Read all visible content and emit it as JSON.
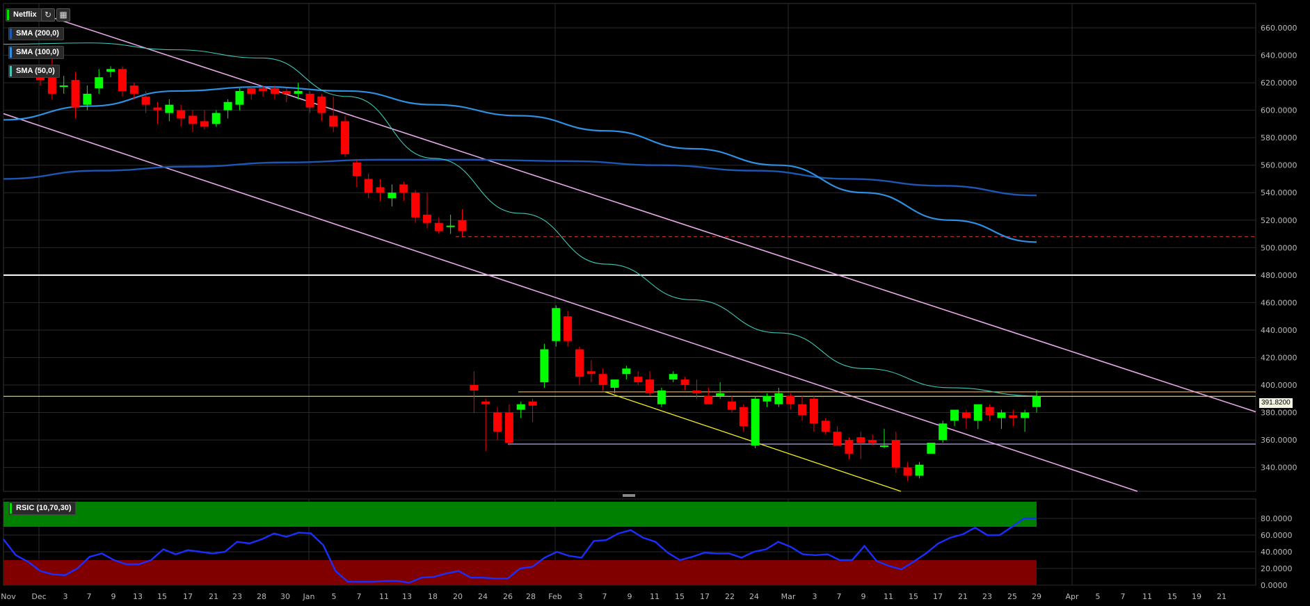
{
  "symbol": "Netflix",
  "indicators": [
    "SMA (200,0)",
    "SMA (100,0)",
    "SMA (50,0)"
  ],
  "rsi_label": "RSIC (10,70,30)",
  "last_price": "391.8200",
  "colors": {
    "background": "#000000",
    "grid": "#2a2a2a",
    "bull": "#00ff00",
    "bear": "#ff0000",
    "sma200": "#1e56b4",
    "sma100": "#2f8fe0",
    "sma50": "#3ec9b8",
    "channel": "#e8a8e8",
    "rsi_line": "#1a2fff",
    "overbought": "#008000",
    "oversold": "#800000"
  },
  "chart_data": {
    "type": "candlestick",
    "price_ticks": [
      "660.0000",
      "640.0000",
      "620.0000",
      "600.0000",
      "580.0000",
      "560.0000",
      "540.0000",
      "520.0000",
      "500.0000",
      "480.0000",
      "460.0000",
      "440.0000",
      "420.0000",
      "400.0000",
      "380.0000",
      "360.0000",
      "340.0000"
    ],
    "rsi_ticks": [
      "80.0000",
      "60.0000",
      "40.0000",
      "20.0000",
      "0.0000"
    ],
    "x_labels": [
      "Nov",
      "Dec",
      "3",
      "7",
      "9",
      "13",
      "15",
      "17",
      "21",
      "23",
      "28",
      "30",
      "Jan",
      "5",
      "7",
      "11",
      "13",
      "18",
      "20",
      "24",
      "26",
      "28",
      "Feb",
      "3",
      "7",
      "9",
      "11",
      "15",
      "17",
      "22",
      "24",
      "Mar",
      "3",
      "7",
      "9",
      "11",
      "15",
      "17",
      "21",
      "23",
      "25",
      "29",
      "Apr",
      "5",
      "7",
      "11",
      "15",
      "19",
      "21"
    ],
    "candles": [
      {
        "o": 628,
        "h": 632,
        "l": 618,
        "c": 622
      },
      {
        "o": 624,
        "h": 640,
        "l": 608,
        "c": 612
      },
      {
        "o": 618,
        "h": 625,
        "l": 612,
        "c": 618
      },
      {
        "o": 622,
        "h": 628,
        "l": 594,
        "c": 602
      },
      {
        "o": 604,
        "h": 618,
        "l": 600,
        "c": 612
      },
      {
        "o": 616,
        "h": 630,
        "l": 612,
        "c": 624
      },
      {
        "o": 628,
        "h": 632,
        "l": 624,
        "c": 630
      },
      {
        "o": 630,
        "h": 632,
        "l": 610,
        "c": 614
      },
      {
        "o": 618,
        "h": 620,
        "l": 608,
        "c": 612
      },
      {
        "o": 610,
        "h": 614,
        "l": 598,
        "c": 604
      },
      {
        "o": 602,
        "h": 606,
        "l": 590,
        "c": 600
      },
      {
        "o": 598,
        "h": 608,
        "l": 592,
        "c": 604
      },
      {
        "o": 600,
        "h": 604,
        "l": 588,
        "c": 594
      },
      {
        "o": 596,
        "h": 600,
        "l": 584,
        "c": 590
      },
      {
        "o": 592,
        "h": 600,
        "l": 586,
        "c": 588
      },
      {
        "o": 590,
        "h": 600,
        "l": 588,
        "c": 598
      },
      {
        "o": 600,
        "h": 608,
        "l": 594,
        "c": 606
      },
      {
        "o": 604,
        "h": 616,
        "l": 600,
        "c": 614
      },
      {
        "o": 616,
        "h": 618,
        "l": 608,
        "c": 612
      },
      {
        "o": 616,
        "h": 618,
        "l": 610,
        "c": 614
      },
      {
        "o": 616,
        "h": 618,
        "l": 608,
        "c": 612
      },
      {
        "o": 614,
        "h": 616,
        "l": 606,
        "c": 612
      },
      {
        "o": 612,
        "h": 620,
        "l": 608,
        "c": 614
      },
      {
        "o": 612,
        "h": 614,
        "l": 598,
        "c": 602
      },
      {
        "o": 610,
        "h": 612,
        "l": 592,
        "c": 598
      },
      {
        "o": 596,
        "h": 610,
        "l": 584,
        "c": 588
      },
      {
        "o": 592,
        "h": 596,
        "l": 566,
        "c": 568
      },
      {
        "o": 562,
        "h": 564,
        "l": 544,
        "c": 552
      },
      {
        "o": 550,
        "h": 554,
        "l": 536,
        "c": 540
      },
      {
        "o": 544,
        "h": 550,
        "l": 534,
        "c": 540
      },
      {
        "o": 536,
        "h": 546,
        "l": 530,
        "c": 540
      },
      {
        "o": 546,
        "h": 548,
        "l": 534,
        "c": 540
      },
      {
        "o": 540,
        "h": 542,
        "l": 518,
        "c": 522
      },
      {
        "o": 524,
        "h": 540,
        "l": 514,
        "c": 518
      },
      {
        "o": 518,
        "h": 522,
        "l": 510,
        "c": 512
      },
      {
        "o": 516,
        "h": 524,
        "l": 510,
        "c": 516
      },
      {
        "o": 520,
        "h": 528,
        "l": 508,
        "c": 512
      },
      {
        "o": 400,
        "h": 410,
        "l": 380,
        "c": 396
      },
      {
        "o": 388,
        "h": 390,
        "l": 352,
        "c": 386
      },
      {
        "o": 380,
        "h": 384,
        "l": 360,
        "c": 366
      },
      {
        "o": 380,
        "h": 386,
        "l": 356,
        "c": 358
      },
      {
        "o": 382,
        "h": 388,
        "l": 376,
        "c": 386
      },
      {
        "o": 388,
        "h": 390,
        "l": 373,
        "c": 385
      },
      {
        "o": 402,
        "h": 430,
        "l": 398,
        "c": 426
      },
      {
        "o": 432,
        "h": 458,
        "l": 428,
        "c": 456
      },
      {
        "o": 450,
        "h": 454,
        "l": 428,
        "c": 432
      },
      {
        "o": 426,
        "h": 428,
        "l": 400,
        "c": 406
      },
      {
        "o": 410,
        "h": 418,
        "l": 402,
        "c": 408
      },
      {
        "o": 408,
        "h": 412,
        "l": 396,
        "c": 400
      },
      {
        "o": 398,
        "h": 404,
        "l": 394,
        "c": 404
      },
      {
        "o": 408,
        "h": 414,
        "l": 404,
        "c": 412
      },
      {
        "o": 406,
        "h": 410,
        "l": 400,
        "c": 402
      },
      {
        "o": 404,
        "h": 410,
        "l": 392,
        "c": 394
      },
      {
        "o": 386,
        "h": 398,
        "l": 384,
        "c": 396
      },
      {
        "o": 404,
        "h": 410,
        "l": 402,
        "c": 408
      },
      {
        "o": 404,
        "h": 406,
        "l": 396,
        "c": 400
      },
      {
        "o": 396,
        "h": 404,
        "l": 390,
        "c": 394
      },
      {
        "o": 392,
        "h": 398,
        "l": 386,
        "c": 386
      },
      {
        "o": 392,
        "h": 402,
        "l": 390,
        "c": 394
      },
      {
        "o": 388,
        "h": 392,
        "l": 380,
        "c": 382
      },
      {
        "o": 384,
        "h": 386,
        "l": 366,
        "c": 370
      },
      {
        "o": 356,
        "h": 392,
        "l": 354,
        "c": 390
      },
      {
        "o": 388,
        "h": 394,
        "l": 384,
        "c": 392
      },
      {
        "o": 386,
        "h": 398,
        "l": 384,
        "c": 394
      },
      {
        "o": 392,
        "h": 394,
        "l": 382,
        "c": 386
      },
      {
        "o": 386,
        "h": 392,
        "l": 374,
        "c": 378
      },
      {
        "o": 390,
        "h": 392,
        "l": 366,
        "c": 372
      },
      {
        "o": 374,
        "h": 376,
        "l": 364,
        "c": 366
      },
      {
        "o": 366,
        "h": 370,
        "l": 356,
        "c": 356
      },
      {
        "o": 360,
        "h": 362,
        "l": 346,
        "c": 350
      },
      {
        "o": 362,
        "h": 366,
        "l": 346,
        "c": 358
      },
      {
        "o": 360,
        "h": 364,
        "l": 356,
        "c": 358
      },
      {
        "o": 356,
        "h": 368,
        "l": 354,
        "c": 356
      },
      {
        "o": 360,
        "h": 366,
        "l": 336,
        "c": 340
      },
      {
        "o": 340,
        "h": 344,
        "l": 330,
        "c": 334
      },
      {
        "o": 334,
        "h": 344,
        "l": 332,
        "c": 342
      },
      {
        "o": 350,
        "h": 358,
        "l": 350,
        "c": 358
      },
      {
        "o": 360,
        "h": 374,
        "l": 358,
        "c": 372
      },
      {
        "o": 374,
        "h": 382,
        "l": 370,
        "c": 382
      },
      {
        "o": 380,
        "h": 382,
        "l": 368,
        "c": 376
      },
      {
        "o": 374,
        "h": 386,
        "l": 368,
        "c": 386
      },
      {
        "o": 384,
        "h": 386,
        "l": 374,
        "c": 378
      },
      {
        "o": 376,
        "h": 382,
        "l": 368,
        "c": 380
      },
      {
        "o": 378,
        "h": 382,
        "l": 370,
        "c": 376
      },
      {
        "o": 376,
        "h": 382,
        "l": 366,
        "c": 380
      },
      {
        "o": 384,
        "h": 396,
        "l": 380,
        "c": 391.82
      }
    ],
    "rsi": [
      55,
      36,
      28,
      17,
      13,
      12,
      20,
      34,
      38,
      30,
      25,
      25,
      30,
      43,
      37,
      42,
      40,
      38,
      40,
      52,
      50,
      55,
      62,
      58,
      63,
      62,
      48,
      17,
      4,
      4,
      4,
      5,
      5,
      3,
      9,
      10,
      14,
      17,
      9,
      9,
      8,
      8,
      20,
      22,
      33,
      40,
      35,
      33,
      53,
      54,
      62,
      66,
      57,
      52,
      39,
      30,
      34,
      39,
      38,
      38,
      33,
      40,
      43,
      52,
      46,
      37,
      36,
      37,
      30,
      30,
      47,
      29,
      23,
      19,
      28,
      38,
      50,
      57,
      61,
      69,
      60,
      60,
      70,
      80,
      80
    ],
    "sma200": [
      550,
      556,
      559,
      562,
      564,
      564,
      563,
      560,
      556,
      550,
      545,
      538
    ],
    "sma100": [
      593,
      603,
      614,
      617,
      614,
      604,
      596,
      585,
      572,
      560,
      540,
      520,
      504
    ],
    "sma50": [
      648,
      649,
      644,
      638,
      610,
      565,
      525,
      488,
      462,
      438,
      412,
      398,
      392
    ],
    "levels": [
      {
        "price": 480,
        "color": "#ffffff",
        "style": "solid"
      },
      {
        "price": 508,
        "color": "#b03030",
        "style": "dashed"
      },
      {
        "price": 395,
        "color": "#e8a030",
        "style": "solid"
      },
      {
        "price": 357,
        "color": "#b0a8e8",
        "style": "solid"
      }
    ],
    "rsi_overbought": 70,
    "rsi_oversold": 30
  }
}
